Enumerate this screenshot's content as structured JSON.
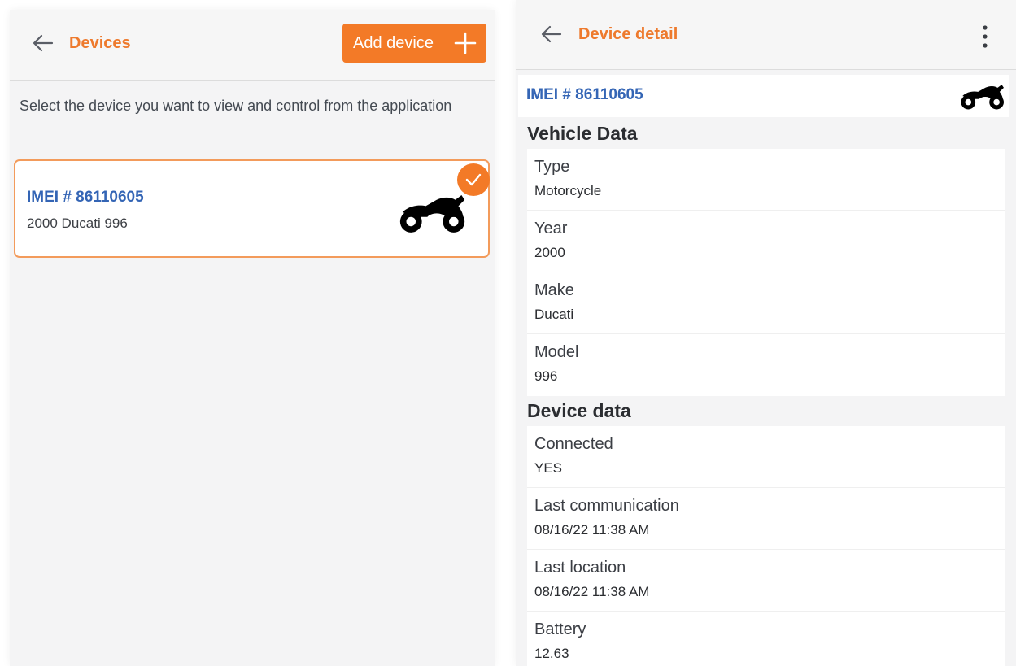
{
  "devices_screen": {
    "title": "Devices",
    "add_button_label": "Add device",
    "intro_text": "Select the device you want to view and control from the application",
    "device": {
      "imei": "IMEI # 86110605",
      "name": "2000 Ducati 996",
      "selected": true
    }
  },
  "detail_screen": {
    "title": "Device detail",
    "imei": "IMEI # 86110605",
    "vehicle_section_title": "Vehicle Data",
    "vehicle_fields": [
      {
        "label": "Type",
        "value": "Motorcycle"
      },
      {
        "label": "Year",
        "value": "2000"
      },
      {
        "label": "Make",
        "value": "Ducati"
      },
      {
        "label": "Model",
        "value": "996"
      }
    ],
    "device_section_title": "Device data",
    "device_fields": [
      {
        "label": "Connected",
        "value": "YES"
      },
      {
        "label": "Last communication",
        "value": "08/16/22 11:38 AM"
      },
      {
        "label": "Last location",
        "value": "08/16/22 11:38 AM"
      },
      {
        "label": "Battery",
        "value": "12.63"
      }
    ]
  },
  "colors": {
    "accent": "#f37a27",
    "link_blue": "#3465b5",
    "background": "#f4f4f5"
  },
  "icons": [
    "back-arrow-icon",
    "plus-icon",
    "check-icon",
    "motorcycle-icon",
    "more-vertical-icon"
  ]
}
